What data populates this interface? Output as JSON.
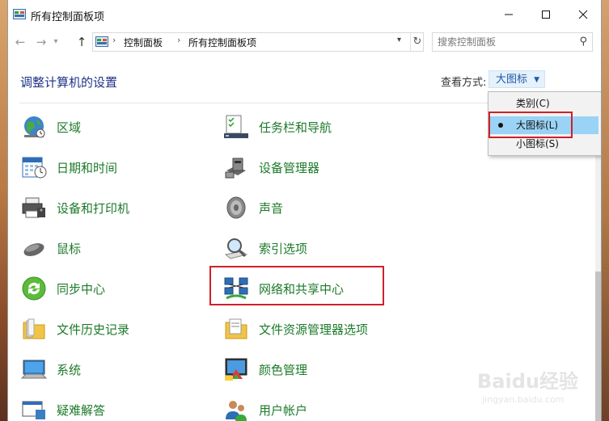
{
  "window": {
    "title": "所有控制面板项"
  },
  "address": {
    "crumbs": [
      "控制面板",
      "所有控制面板项"
    ]
  },
  "search": {
    "placeholder": "搜索控制面板"
  },
  "header": {
    "title": "调整计算机的设置",
    "view_by_label": "查看方式:",
    "view_by_value": "大图标"
  },
  "view_menu": {
    "items": [
      "类别(C)",
      "大图标(L)",
      "小图标(S)"
    ],
    "selected_index": 1
  },
  "items_col1": [
    "区域",
    "日期和时间",
    "设备和打印机",
    "鼠标",
    "同步中心",
    "文件历史记录",
    "系统",
    "疑难解答"
  ],
  "items_col2": [
    "任务栏和导航",
    "设备管理器",
    "声音",
    "索引选项",
    "网络和共享中心",
    "文件资源管理器选项",
    "颜色管理",
    "用户帐户"
  ],
  "watermark": {
    "line1": "Baidu经验",
    "line2": "jingyan.baidu.com"
  },
  "colors": {
    "link_green": "#1d7a2a",
    "heading_blue": "#1e3287",
    "highlight_red": "#d0202a",
    "menu_selected": "#9ad3f5"
  }
}
